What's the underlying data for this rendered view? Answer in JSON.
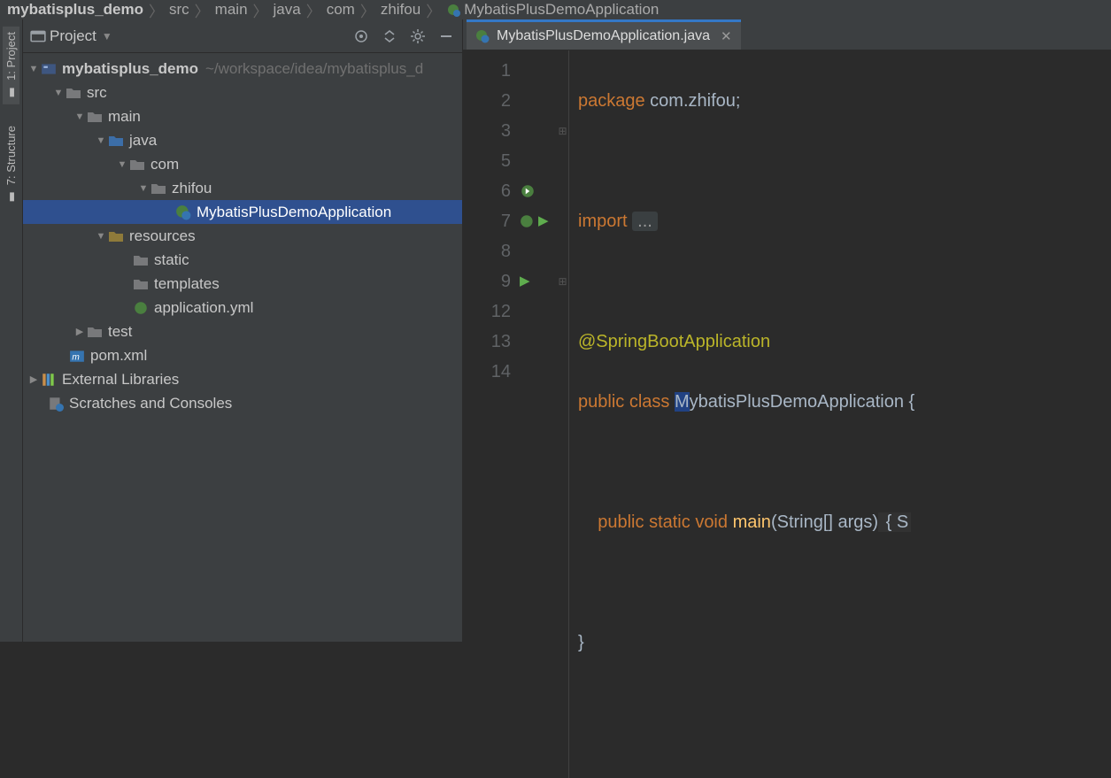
{
  "breadcrumbs": [
    "mybatisplus_demo",
    "src",
    "main",
    "java",
    "com",
    "zhifou",
    "MybatisPlusDemoApplication"
  ],
  "sidebar": {
    "project_tab": "1: Project",
    "structure_tab": "7: Structure"
  },
  "panel": {
    "title": "Project",
    "root_label": "mybatisplus_demo",
    "root_path": "~/workspace/idea/mybatisplus_d",
    "src": "src",
    "main": "main",
    "java": "java",
    "com": "com",
    "zhifou": "zhifou",
    "app_class": "MybatisPlusDemoApplication",
    "resources": "resources",
    "static": "static",
    "templates": "templates",
    "appyml": "application.yml",
    "test": "test",
    "pom": "pom.xml",
    "external": "External Libraries",
    "scratches": "Scratches and Consoles"
  },
  "tab": {
    "label": "MybatisPlusDemoApplication.java"
  },
  "code": {
    "l1_a": "package",
    "l1_b": " com.zhifou;",
    "l3_a": "import",
    "l3_b": "...",
    "l6": "@SpringBootApplication",
    "l7_a": "public",
    "l7_b": "class",
    "l7_c": "MybatisPlusDemoApplication",
    "l7_c_first": "M",
    "l7_c_rest": "ybatisPlusDemoApplication",
    "l7_d": " {",
    "l9_a": "public",
    "l9_b": "static",
    "l9_c": "void",
    "l9_d": "main",
    "l9_e": "(String[] args)",
    "l9_f": " { S",
    "l12": "}",
    "linenos": [
      "1",
      "2",
      "3",
      "5",
      "6",
      "7",
      "8",
      "9",
      "12",
      "13",
      "14"
    ]
  }
}
